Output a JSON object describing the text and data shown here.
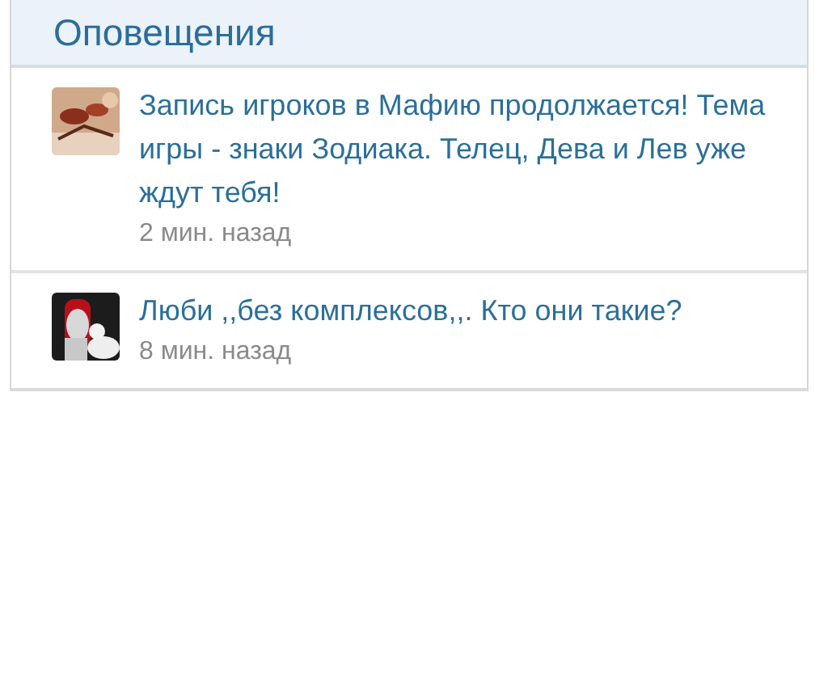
{
  "panel": {
    "title": "Оповещения"
  },
  "notifications": [
    {
      "text": "Запись игроков в Мафию продолжается! Тема игры - знаки Зодиака. Телец, Дева и Лев уже ждут тебя!",
      "time": "2 мин. назад"
    },
    {
      "text": "Люби ,,без комплексов,,. Кто они такие?",
      "time": "8 мин. назад"
    }
  ]
}
